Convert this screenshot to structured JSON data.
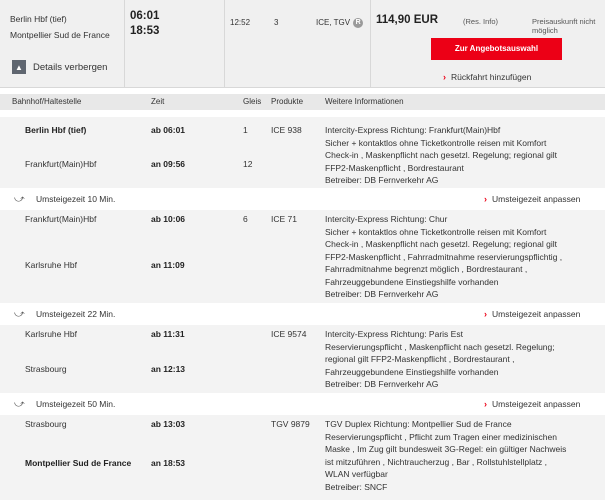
{
  "summary": {
    "from": "Berlin Hbf (tief)",
    "to": "Montpellier Sud de France",
    "dep_time": "06:01",
    "arr_time": "18:53",
    "duration": "12:52",
    "changes": "3",
    "products": "ICE, TGV",
    "price": "114,90 EUR",
    "price_note": "(Res. Info)",
    "price_info": "Preisauskunft nicht möglich",
    "cta_label": "Zur Angebotsauswahl",
    "return_label": "Rückfahrt hinzufügen",
    "toggle_label": "Details verbergen",
    "toggle_icon": "▲"
  },
  "table": {
    "headers": [
      "Bahnhof/Haltestelle",
      "Zeit",
      "Gleis",
      "Produkte",
      "Weitere Informationen"
    ]
  },
  "segments": [
    {
      "dep_station": "Berlin Hbf (tief)",
      "dep_time": "ab 06:01",
      "dep_platform": "1",
      "arr_station": "Frankfurt(Main)Hbf",
      "arr_time": "an 09:56",
      "arr_platform": "12",
      "product": "ICE 938",
      "info": [
        "Intercity-Express Richtung: Frankfurt(Main)Hbf",
        "Sicher + kontaktlos ohne Ticketkontrolle reisen mit Komfort",
        "Check-in , Maskenpflicht nach gesetzl. Regelung; regional gilt",
        "FFP2-Maskenpflicht , Bordrestaurant",
        "Betreiber: DB Fernverkehr AG"
      ]
    },
    {
      "dep_station": "Frankfurt(Main)Hbf",
      "dep_time": "ab 10:06",
      "dep_platform": "6",
      "arr_station": "Karlsruhe Hbf",
      "arr_time": "an 11:09",
      "arr_platform": "",
      "product": "ICE 71",
      "info": [
        "Intercity-Express Richtung: Chur",
        "Sicher + kontaktlos ohne Ticketkontrolle reisen mit Komfort",
        "Check-in , Maskenpflicht nach gesetzl. Regelung; regional gilt",
        "FFP2-Maskenpflicht , Fahrradmitnahme reservierungspflichtig ,",
        "Fahrradmitnahme begrenzt möglich , Bordrestaurant ,",
        "Fahrzeuggebundene Einstiegshilfe vorhanden",
        "Betreiber: DB Fernverkehr AG"
      ]
    },
    {
      "dep_station": "Karlsruhe Hbf",
      "dep_time": "ab 11:31",
      "dep_platform": "",
      "arr_station": "Strasbourg",
      "arr_time": "an 12:13",
      "arr_platform": "",
      "product": "ICE 9574",
      "info": [
        "Intercity-Express Richtung: Paris Est",
        "Reservierungspflicht , Maskenpflicht nach gesetzl. Regelung;",
        "regional gilt FFP2-Maskenpflicht , Bordrestaurant ,",
        "Fahrzeuggebundene Einstiegshilfe vorhanden",
        "Betreiber: DB Fernverkehr AG"
      ]
    },
    {
      "dep_station": "Strasbourg",
      "dep_time": "ab 13:03",
      "dep_platform": "",
      "arr_station": "Montpellier Sud de France",
      "arr_time": "an 18:53",
      "arr_platform": "",
      "product": "TGV 9879",
      "info": [
        "TGV Duplex Richtung: Montpellier Sud de France",
        "Reservierungspflicht , Pflicht zum Tragen einer medizinischen",
        "Maske , Im Zug gilt bundesweit 3G-Regel: ein gültiger Nachweis",
        "ist mitzuführen , Nichtraucherzug , Bar , Rollstuhlstellplatz ,",
        "WLAN verfügbar",
        "Betreiber: SNCF"
      ]
    }
  ],
  "transfers": [
    {
      "label": "Umsteigezeit 10 Min.",
      "action": "Umsteigezeit anpassen"
    },
    {
      "label": "Umsteigezeit 22 Min.",
      "action": "Umsteigezeit anpassen"
    },
    {
      "label": "Umsteigezeit 50 Min.",
      "action": "Umsteigezeit anpassen"
    }
  ],
  "icons": {
    "transfer": "walk-transfer-icon",
    "chevron": "chevron-right-icon",
    "reservation": "reservation-badge-icon"
  },
  "colors": {
    "accent": "#ec0016",
    "section_bg": "#f3f3f3",
    "summary_bg": "#f0f0f0"
  }
}
